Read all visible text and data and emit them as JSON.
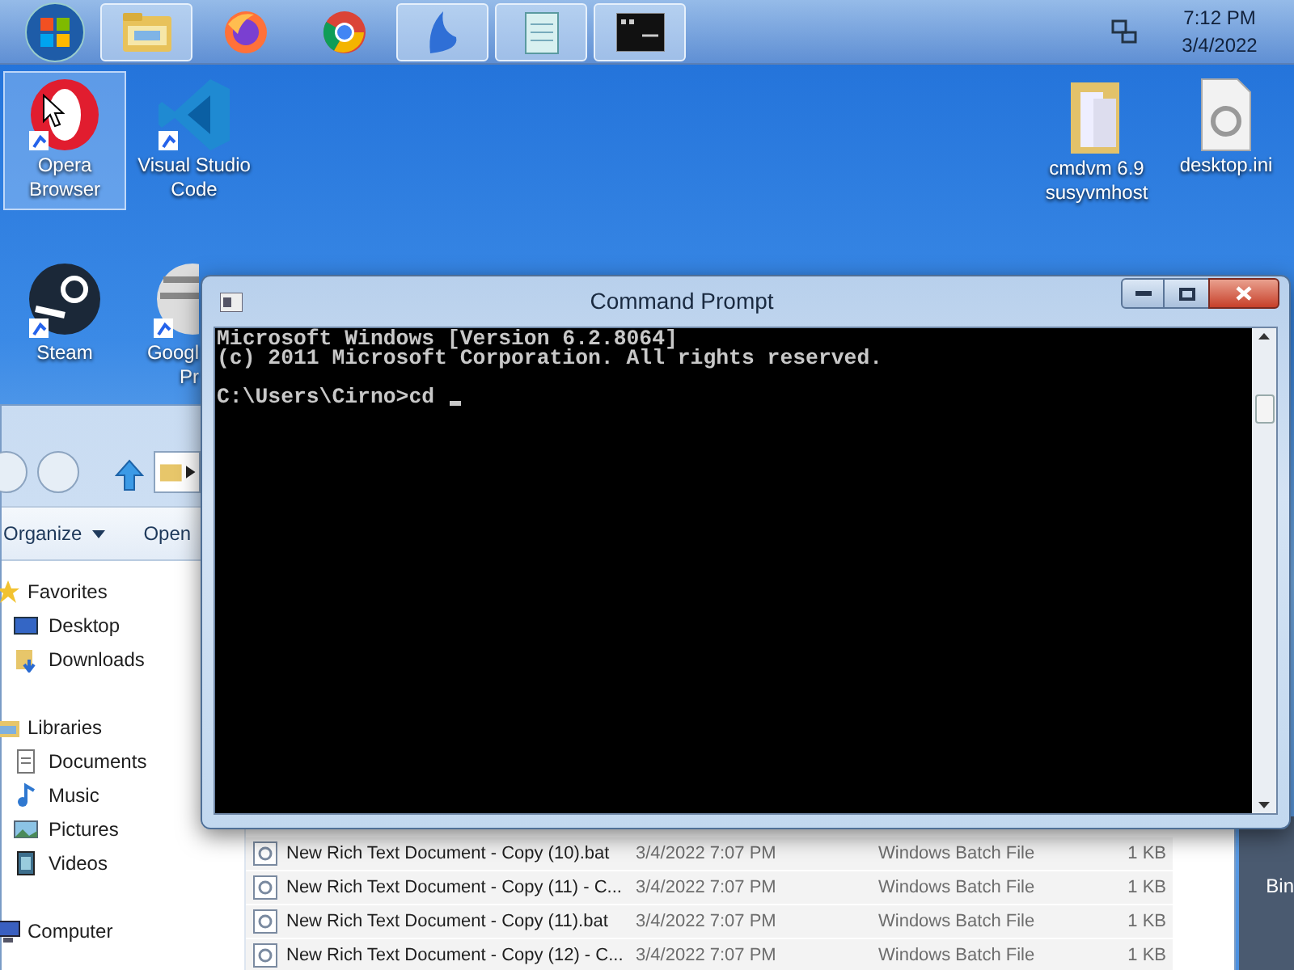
{
  "taskbar": {
    "buttons": [
      {
        "kind": "explorer",
        "running": true
      },
      {
        "kind": "firefox",
        "running": false
      },
      {
        "kind": "chrome",
        "running": false
      },
      {
        "kind": "feather",
        "running": true
      },
      {
        "kind": "notepad",
        "running": true
      },
      {
        "kind": "console",
        "running": true
      }
    ],
    "clock": {
      "time": "7:12 PM",
      "date": "3/4/2022"
    }
  },
  "desktop_icons": [
    {
      "kind": "opera",
      "lines": [
        "Opera",
        "Browser"
      ],
      "selected": true
    },
    {
      "kind": "vscode",
      "lines": [
        "Visual Studio",
        "Code"
      ],
      "selected": false
    },
    {
      "kind": "folder",
      "lines": [
        "cmdvm 6.9",
        "susyvmhost"
      ],
      "selected": false
    },
    {
      "kind": "file",
      "lines": [
        "desktop.ini"
      ],
      "selected": false
    },
    {
      "kind": "steam",
      "lines": [
        "Steam"
      ],
      "selected": false
    },
    {
      "kind": "balloon",
      "lines": [
        "Googl",
        "Pr"
      ],
      "selected": false
    }
  ],
  "explorer": {
    "toolbar": [
      {
        "label": "Organize",
        "dropdown": true
      },
      {
        "label": "Open",
        "dropdown": false
      }
    ],
    "navigation": [
      {
        "kind": "star",
        "label": "Favorites",
        "children": [
          {
            "kind": "desktop",
            "label": "Desktop"
          },
          {
            "kind": "downloads",
            "label": "Downloads"
          }
        ]
      },
      {
        "kind": "libraries",
        "label": "Libraries",
        "children": [
          {
            "kind": "document",
            "label": "Documents"
          },
          {
            "kind": "music",
            "label": "Music"
          },
          {
            "kind": "pictures",
            "label": "Pictures"
          },
          {
            "kind": "videos",
            "label": "Videos"
          }
        ]
      },
      {
        "kind": "computer",
        "label": "Computer"
      }
    ],
    "files": [
      {
        "name": "New Rich Text Document - Copy (10).bat",
        "date": "3/4/2022 7:07 PM",
        "type": "Windows Batch File",
        "size": "1 KB"
      },
      {
        "name": "New Rich Text Document - Copy (11) - C...",
        "date": "3/4/2022 7:07 PM",
        "type": "Windows Batch File",
        "size": "1 KB"
      },
      {
        "name": "New Rich Text Document - Copy (11).bat",
        "date": "3/4/2022 7:07 PM",
        "type": "Windows Batch File",
        "size": "1 KB"
      },
      {
        "name": "New Rich Text Document - Copy (12) - C...",
        "date": "3/4/2022 7:07 PM",
        "type": "Windows Batch File",
        "size": "1 KB"
      }
    ]
  },
  "console": {
    "title": "Command Prompt",
    "output": [
      "Microsoft Windows [Version 6.2.8064]",
      "(c) 2011 Microsoft Corporation. All rights reserved."
    ],
    "prompt": "C:\\Users\\Cirno>cd"
  },
  "partial_window": {
    "label": "Bin"
  }
}
